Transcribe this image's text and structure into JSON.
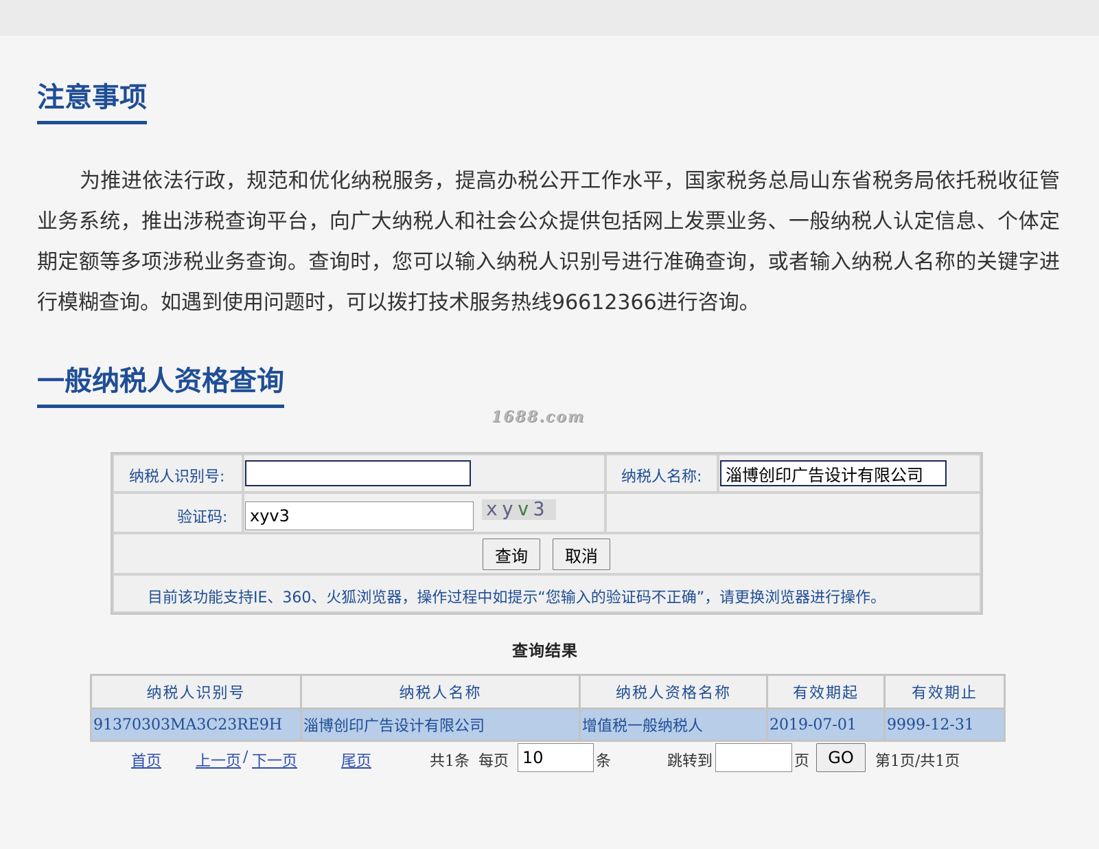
{
  "notes": {
    "title": "注意事项",
    "body": "为推进依法行政，规范和优化纳税服务，提高办税公开工作水平，国家税务总局山东省税务局依托税收征管业务系统，推出涉税查询平台，向广大纳税人和社会公众提供包括网上发票业务、一般纳税人认定信息、个体定期定额等多项涉税业务查询。查询时，您可以输入纳税人识别号进行准确查询，或者输入纳税人名称的关键字进行模糊查询。如遇到使用问题时，可以拨打技术服务热线96612366进行咨询。"
  },
  "query": {
    "title": "一般纳税人资格查询",
    "watermark": "1688.com",
    "taxpayer_id_label": "纳税人识别号:",
    "taxpayer_id_value": "",
    "taxpayer_name_label": "纳税人名称:",
    "taxpayer_name_value": "淄博创印广告设计有限公司",
    "captcha_label": "验证码:",
    "captcha_value": "xyv3",
    "captcha_image_text": [
      "x",
      "y",
      "v",
      "3"
    ],
    "search_button": "查询",
    "cancel_button": "取消",
    "hint": "目前该功能支持IE、360、火狐浏览器，操作过程中如提示“您输入的验证码不正确”，请更换浏览器进行操作。"
  },
  "results": {
    "title": "查询结果",
    "columns": [
      "纳税人识别号",
      "纳税人名称",
      "纳税人资格名称",
      "有效期起",
      "有效期止"
    ],
    "rows": [
      [
        "91370303MA3C23RE9H",
        "淄博创印广告设计有限公司",
        "增值税一般纳税人",
        "2019-07-01",
        "9999-12-31"
      ]
    ]
  },
  "pager": {
    "first": "首页",
    "prev": "上一页",
    "sep": "/",
    "next": "下一页",
    "last": "尾页",
    "total": "共1条",
    "per_page_label": "每页",
    "per_page_value": "10",
    "per_page_unit": "条",
    "jump_label": "跳转到",
    "jump_value": "",
    "jump_unit": "页",
    "go_button": "GO",
    "page_info": "第1页/共1页"
  }
}
